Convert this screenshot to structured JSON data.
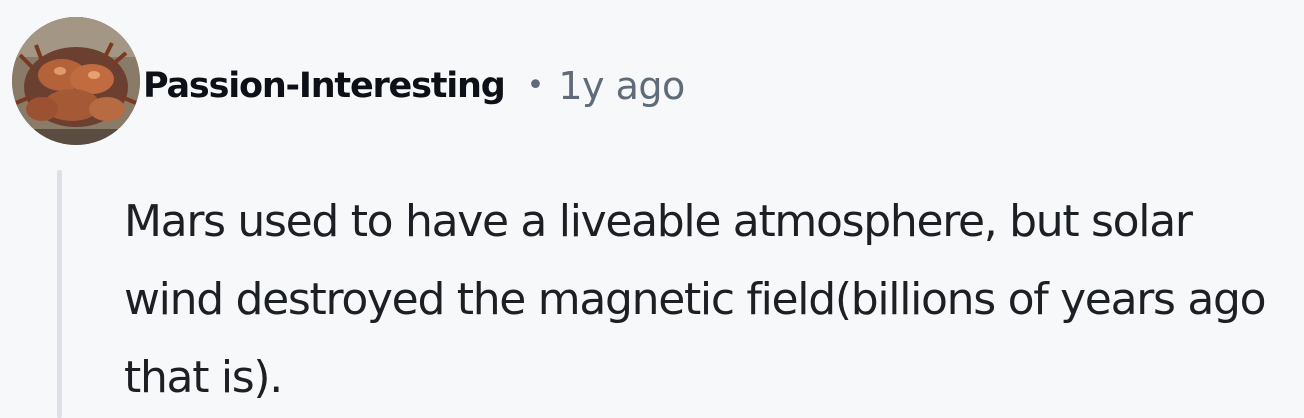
{
  "comment": {
    "author": {
      "username": "Passion-Interesting",
      "avatar": "crab-photo-avatar"
    },
    "separator": "•",
    "timestamp": "1y ago",
    "body": "Mars used to have a liveable atmosphere, but solar wind destroyed the magnetic field(billions of years ago that is)."
  },
  "colors": {
    "background": "#f6f8fa",
    "username": "#0d1117",
    "meta": "#5f6b78",
    "body_text": "#1c1f23",
    "thread_line": "#dde1e6"
  }
}
